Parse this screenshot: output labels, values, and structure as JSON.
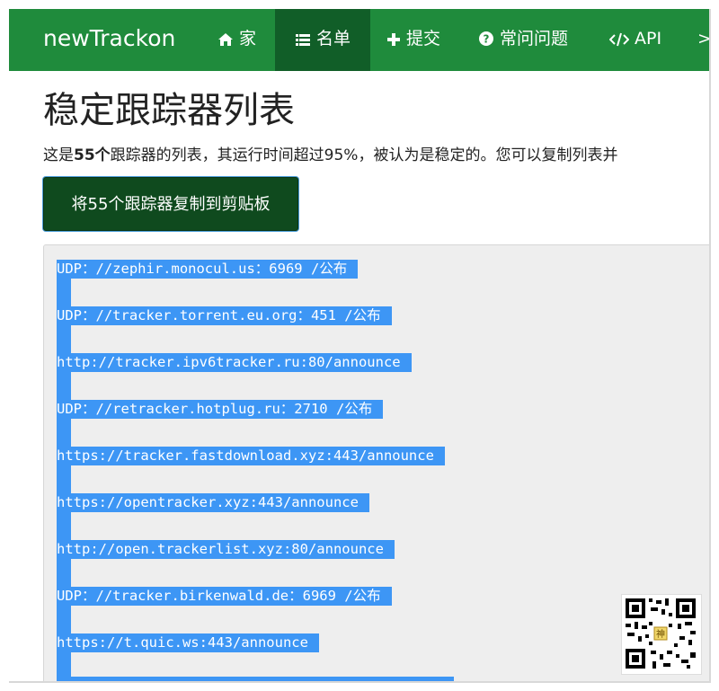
{
  "navbar": {
    "brand": "newTrackon",
    "items": [
      {
        "label": "家",
        "icon": "home-icon"
      },
      {
        "label": "名单",
        "icon": "list-icon",
        "active": true
      },
      {
        "label": "提交",
        "icon": "plus-icon"
      },
      {
        "label": "常问问题",
        "icon": "question-icon"
      },
      {
        "label": "API",
        "icon": "code-icon"
      },
      {
        "label": ">_",
        "icon": "terminal-icon"
      }
    ]
  },
  "page": {
    "title": "稳定跟踪器列表",
    "desc_prefix": "这是",
    "desc_count": "55个",
    "desc_suffix": "跟踪器的列表，其运行时间超过95%，被认为是稳定的。您可以复制列表并",
    "copy_button": "将55个跟踪器复制到剪贴板"
  },
  "trackers": [
    "UDP：//zephir.monocul.us：6969 /公布",
    "UDP：//tracker.torrent.eu.org：451 /公布",
    "http://tracker.ipv6tracker.ru:80/announce",
    "UDP：//retracker.hotplug.ru：2710 /公布",
    "https://tracker.fastdownload.xyz:443/announce",
    "https://opentracker.xyz:443/announce",
    "http://open.trackerlist.xyz:80/announce",
    "UDP：//tracker.birkenwald.de：6969 /公布",
    "https://t.quic.ws:443/announce"
  ],
  "qr_center_glyph": "神",
  "colors": {
    "navbar": "#1f8b3c",
    "navbar_active": "#115e28",
    "button": "#0f4a1e",
    "selection": "#3d96f5",
    "list_bg": "#eeeeee"
  }
}
